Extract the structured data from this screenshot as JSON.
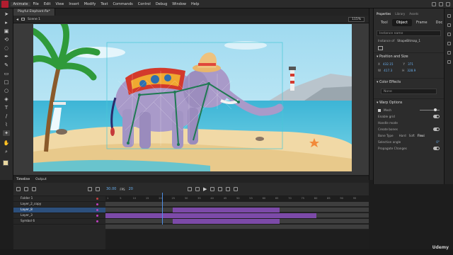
{
  "menubar": {
    "app": "Animate",
    "items": [
      "File",
      "Edit",
      "View",
      "Insert",
      "Modify",
      "Text",
      "Commands",
      "Control",
      "Debug",
      "Window",
      "Help"
    ]
  },
  "document": {
    "tab_label": "Playful Elephant.fla*"
  },
  "scene": {
    "label": "Scene 1",
    "zoom": "115%"
  },
  "properties": {
    "panel_tabs": [
      "Properties",
      "Library",
      "Assets"
    ],
    "sub_tabs": [
      "Tool",
      "Object",
      "Frame",
      "Doc"
    ],
    "instance_name_placeholder": "Instance name",
    "instance_of": "Instance of",
    "instance_name": "ShapeBitmap_1",
    "position_title": "Position and Size",
    "x": "432.15",
    "y": "371",
    "w": "417.3",
    "h": "328.9",
    "color_effects_title": "Color Effects",
    "color_effect_value": "None",
    "warp_title": "Warp Options",
    "mesh_label": "Mesh",
    "rows": [
      "Enable grid",
      "Handle mode",
      "Create bones",
      "Bone Type",
      "Selection angle",
      "Propagate Changes"
    ],
    "bone_types": [
      "Hard",
      "Soft",
      "Flexi"
    ],
    "angle_value": "0°"
  },
  "timeline": {
    "tabs": [
      "Timeline",
      "Output"
    ],
    "fps": "30.00",
    "frame": "20",
    "layers": [
      {
        "name": "Folder 1",
        "color": "#c04040"
      },
      {
        "name": "Layer_2_copy",
        "color": "#c040c0"
      },
      {
        "name": "Layer_8",
        "color": "#c040c0",
        "selected": true
      },
      {
        "name": "Layer_3",
        "color": "#c040c0"
      },
      {
        "name": "Symbol 6",
        "color": "#c040c0"
      }
    ],
    "frame_numbers": [
      "1",
      "5",
      "10",
      "15",
      "20",
      "25",
      "30",
      "35",
      "40",
      "45",
      "50",
      "55",
      "60",
      "65",
      "70",
      "75",
      "80",
      "85",
      "90",
      "95"
    ],
    "tweens": [
      {
        "row": 1,
        "start": 0.255,
        "end": 0.66
      },
      {
        "row": 2,
        "start": 0.0,
        "end": 0.8
      },
      {
        "row": 3,
        "start": 0.255,
        "end": 0.66
      }
    ],
    "playhead_frame": 20
  },
  "watermark": "Udemy",
  "colors": {
    "accent": "#4d8ee6",
    "tween": "#7c4aa8",
    "selected_layer": "#2c4f7c",
    "brand": "#b01d2f"
  }
}
